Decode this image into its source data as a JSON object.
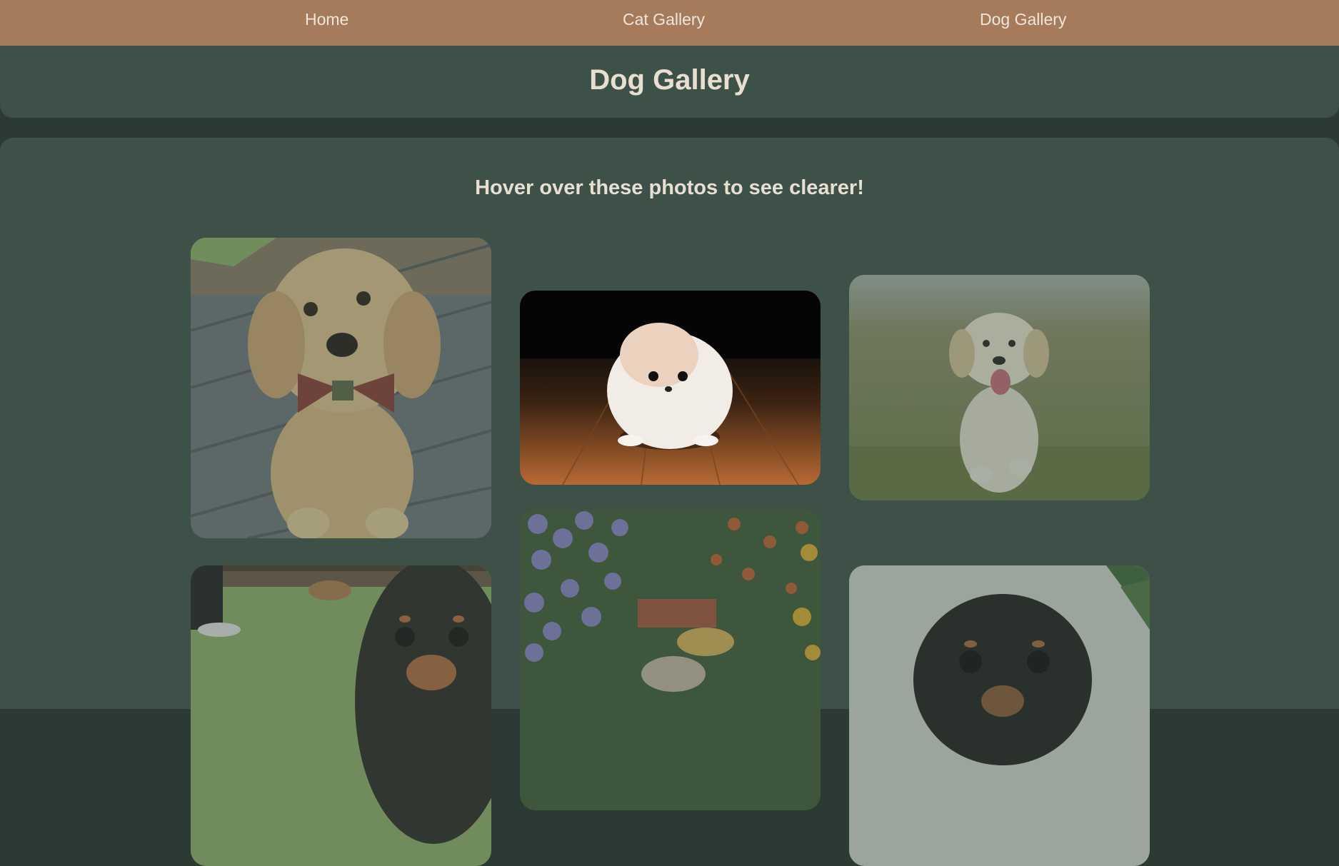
{
  "nav": {
    "home": "Home",
    "cat_gallery": "Cat Gallery",
    "dog_gallery": "Dog Gallery"
  },
  "header": {
    "title": "Dog Gallery"
  },
  "main": {
    "heading": "Hover over these photos to see clearer!",
    "photos": [
      {
        "name": "golden-retriever-puppy-bowtie",
        "state": "dimmed"
      },
      {
        "name": "white-pomeranian-puppy",
        "state": "clear"
      },
      {
        "name": "golden-retriever-puppy-running",
        "state": "dimmed"
      },
      {
        "name": "dachshund-puppy-on-lawn",
        "state": "dimmed"
      },
      {
        "name": "puppy-among-flowers",
        "state": "dimmed"
      },
      {
        "name": "black-dachshund-puppy",
        "state": "dimmed"
      }
    ]
  },
  "colors": {
    "nav_bg": "#a57b5b",
    "panel_bg": "#3e5148",
    "page_bg": "#2b3a32",
    "text": "#e7dfd0"
  }
}
